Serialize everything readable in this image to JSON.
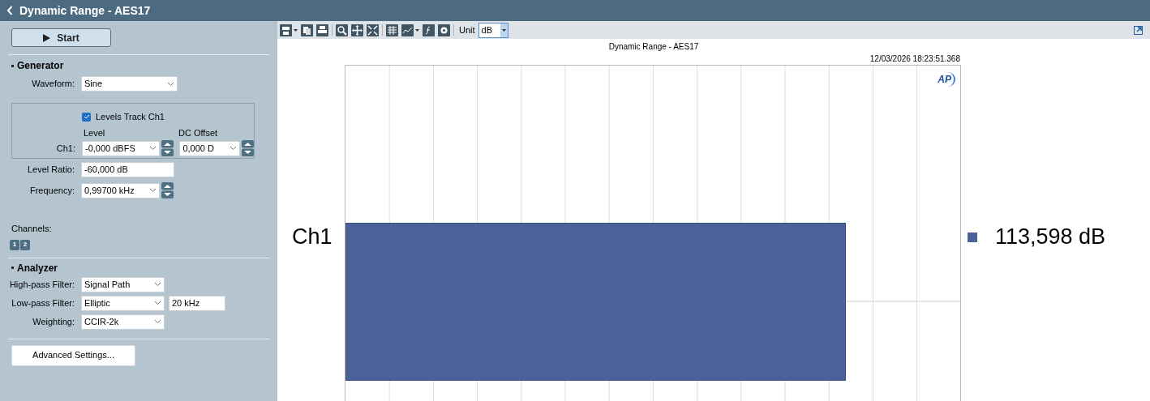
{
  "window": {
    "title": "Dynamic Range - AES17"
  },
  "start_button": {
    "label": "Start"
  },
  "generator": {
    "heading": "Generator",
    "waveform": {
      "label": "Waveform:",
      "value": "Sine"
    },
    "levels_track": {
      "label": "Levels Track Ch1",
      "checked": true
    },
    "level_heading": "Level",
    "dc_offset_heading": "DC Offset",
    "ch1": {
      "label": "Ch1:",
      "level": "-0,000 dBFS",
      "dc_offset": "0,000 D"
    },
    "level_ratio": {
      "label": "Level Ratio:",
      "value": "-60,000 dB"
    },
    "frequency": {
      "label": "Frequency:",
      "value": "0,99700 kHz"
    },
    "channels": {
      "label": "Channels:",
      "buttons": [
        "1",
        "2"
      ]
    }
  },
  "analyzer": {
    "heading": "Analyzer",
    "fields": [
      {
        "kind": "select",
        "label": "High-pass Filter:",
        "value": "Signal Path"
      },
      {
        "kind": "select_input",
        "label": "Low-pass Filter:",
        "value": "Elliptic",
        "extra": "20 kHz"
      },
      {
        "kind": "select",
        "label": "Weighting:",
        "value": "CCIR-2k"
      }
    ]
  },
  "advanced_button": {
    "label": "Advanced Settings..."
  },
  "toolbar": {
    "unit_label": "Unit",
    "unit_value": "dB"
  },
  "chart": {
    "title": "Dynamic Range - AES17",
    "timestamp": "12/03/2026 18:23:51.368",
    "logo": "AP",
    "category": "Ch1",
    "value_label": "113,598 dB"
  }
}
